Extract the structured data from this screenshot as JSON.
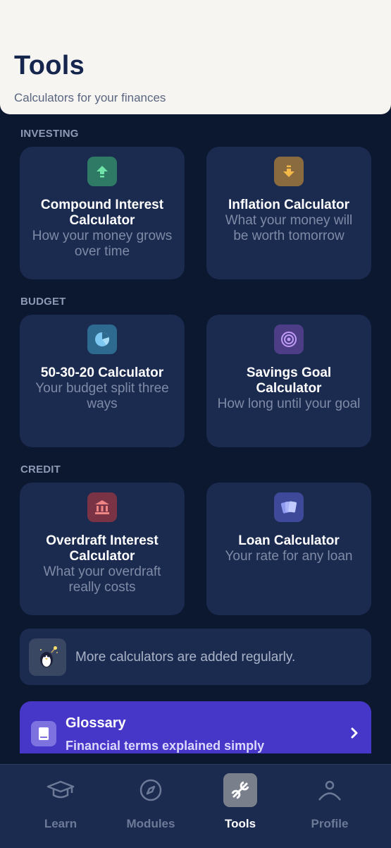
{
  "header": {
    "title": "Tools",
    "subtitle": "Calculators for your finances"
  },
  "sections": [
    {
      "label": "INVESTING",
      "cards": [
        {
          "title": "Compound Interest Calculator",
          "desc": "How your money grows over time",
          "icon": "arrow-up-icon",
          "icon_color": "#2f7a65"
        },
        {
          "title": "Inflation Calculator",
          "desc": "What your money will be worth tomorrow",
          "icon": "arrow-down-icon",
          "icon_color": "#8a6a3f"
        }
      ]
    },
    {
      "label": "BUDGET",
      "cards": [
        {
          "title": "50-30-20 Calculator",
          "desc": "Your budget split three ways",
          "icon": "pie-chart-icon",
          "icon_color": "#2e6a8f"
        },
        {
          "title": "Savings Goal Calculator",
          "desc": "How long until your goal",
          "icon": "target-icon",
          "icon_color": "#4d3d86"
        }
      ]
    },
    {
      "label": "CREDIT",
      "cards": [
        {
          "title": "Overdraft Interest Calculator",
          "desc": "What your overdraft really costs",
          "icon": "bank-icon",
          "icon_color": "#7a3344"
        },
        {
          "title": "Loan Calculator",
          "desc": "Your rate for any loan",
          "icon": "cards-icon",
          "icon_color": "#3e4a99"
        }
      ]
    }
  ],
  "info": {
    "text": "More calculators are added regularly.",
    "icon": "penguin-mascot-icon"
  },
  "glossary": {
    "title": "Glossary",
    "subtitle": "Financial terms explained simply",
    "icon": "book-icon",
    "color": "#4637c8"
  },
  "tabbar": {
    "tabs": [
      {
        "label": "Learn",
        "icon": "graduation-cap-icon",
        "active": false
      },
      {
        "label": "Modules",
        "icon": "compass-icon",
        "active": false
      },
      {
        "label": "Tools",
        "icon": "wrench-icon",
        "active": true
      },
      {
        "label": "Profile",
        "icon": "person-icon",
        "active": false
      }
    ]
  },
  "colors": {
    "background": "#0c1730",
    "card": "#1b2a4f",
    "header": "#f6f5f1",
    "accent": "#4637c8"
  }
}
